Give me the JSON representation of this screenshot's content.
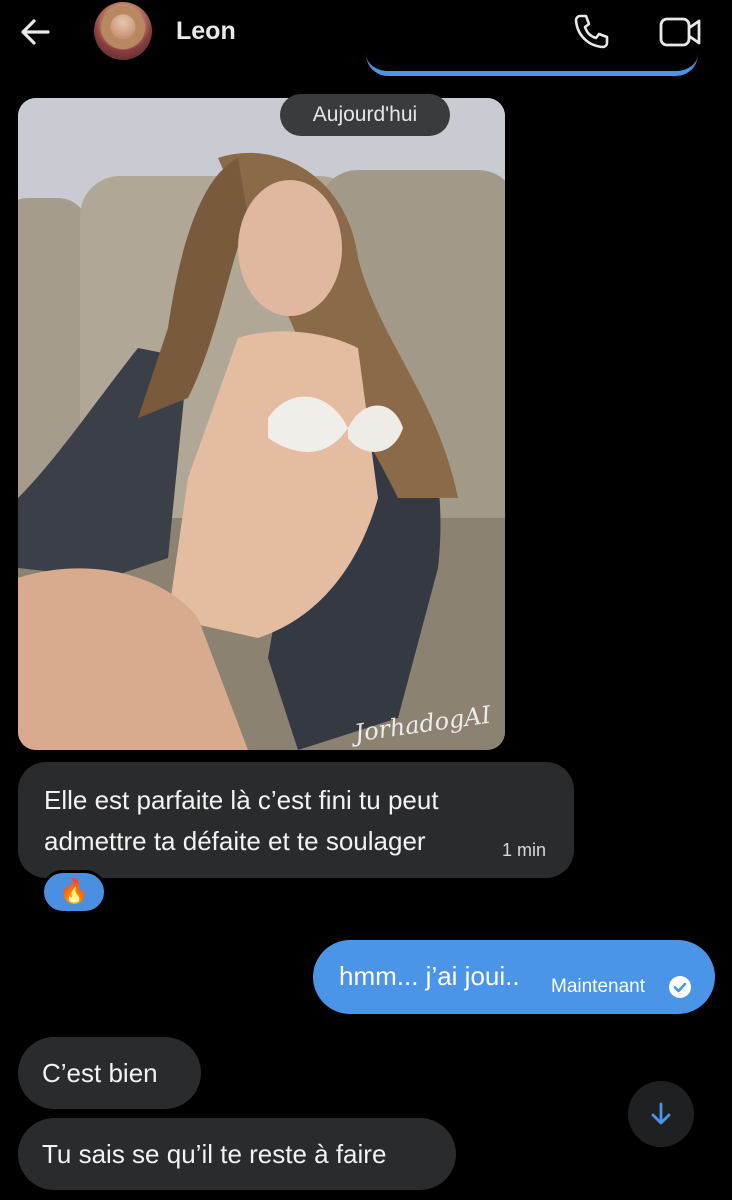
{
  "header": {
    "contact_name": "Leon",
    "icons": [
      "back-arrow-icon",
      "phone-icon",
      "video-camera-icon"
    ]
  },
  "conversation": {
    "date_separator": "Aujourd'hui",
    "photo_watermark": "JorhadogAI",
    "messages": [
      {
        "direction": "received",
        "text_line1": "Elle est parfaite là c’est fini tu peut",
        "text_line2": "admettre ta défaite et te soulager",
        "time": "1 min",
        "reaction": "🔥"
      },
      {
        "direction": "sent",
        "text": "hmm... j’ai joui..",
        "time": "Maintenant",
        "status_icon": "read-check-icon"
      },
      {
        "direction": "received",
        "text": "C’est bien"
      },
      {
        "direction": "received",
        "text": "Tu sais se qu’il te reste à faire"
      }
    ]
  },
  "colors": {
    "background": "#000000",
    "received_bubble": "#2a2b2d",
    "sent_bubble": "#4a95e8",
    "reaction_bg": "#4a8fe0"
  },
  "scroll_button_icon": "arrow-down-icon"
}
